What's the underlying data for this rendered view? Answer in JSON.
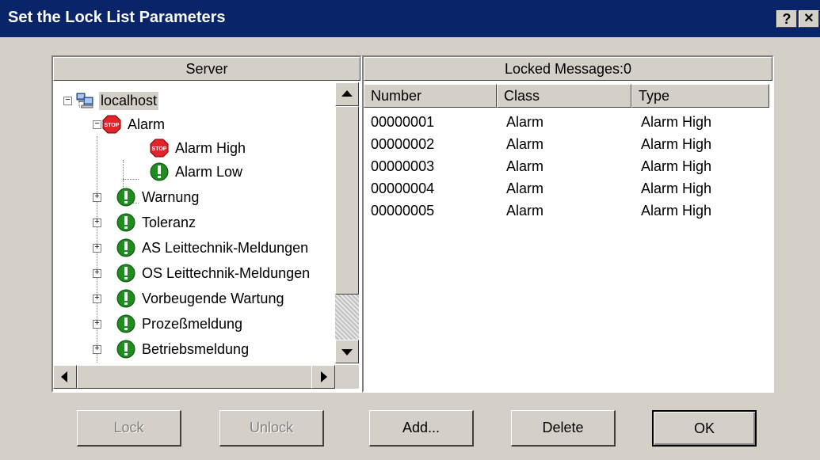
{
  "window": {
    "title": "Set the Lock List Parameters",
    "help_label": "?",
    "close_label": "✕"
  },
  "server_panel": {
    "header": "Server",
    "tree": [
      {
        "label": "localhost",
        "icon": "server-icon",
        "expander": "−",
        "selected": true
      },
      {
        "label": "Alarm",
        "icon": "stop-sign-icon",
        "expander": "−"
      },
      {
        "label": "Alarm High",
        "icon": "stop-sign-icon"
      },
      {
        "label": "Alarm Low",
        "icon": "green-exclamation-icon"
      },
      {
        "label": "Warnung",
        "icon": "green-exclamation-icon",
        "expander": "+"
      },
      {
        "label": "Toleranz",
        "icon": "green-exclamation-icon",
        "expander": "+"
      },
      {
        "label": "AS Leittechnik-Meldungen",
        "icon": "green-exclamation-icon",
        "expander": "+"
      },
      {
        "label": "OS Leittechnik-Meldungen",
        "icon": "green-exclamation-icon",
        "expander": "+"
      },
      {
        "label": "Vorbeugende Wartung",
        "icon": "green-exclamation-icon",
        "expander": "+"
      },
      {
        "label": "Prozeßmeldung",
        "icon": "green-exclamation-icon",
        "expander": "+"
      },
      {
        "label": "Betriebsmeldung",
        "icon": "green-exclamation-icon",
        "expander": "+"
      }
    ]
  },
  "locked_panel": {
    "header": "Locked Messages:0",
    "columns": [
      "Number",
      "Class",
      "Type"
    ],
    "rows": [
      [
        "00000001",
        "Alarm",
        "Alarm High"
      ],
      [
        "00000002",
        "Alarm",
        "Alarm High"
      ],
      [
        "00000003",
        "Alarm",
        "Alarm High"
      ],
      [
        "00000004",
        "Alarm",
        "Alarm High"
      ],
      [
        "00000005",
        "Alarm",
        "Alarm High"
      ]
    ]
  },
  "buttons": {
    "lock": "Lock",
    "unlock": "Unlock",
    "add": "Add...",
    "delete": "Delete",
    "ok": "OK"
  },
  "colors": {
    "title_bar": "#0a246a",
    "dialog_face": "#d4d0c8",
    "stop_red": "#e0242a",
    "ok_green": "#1e8c1e"
  }
}
